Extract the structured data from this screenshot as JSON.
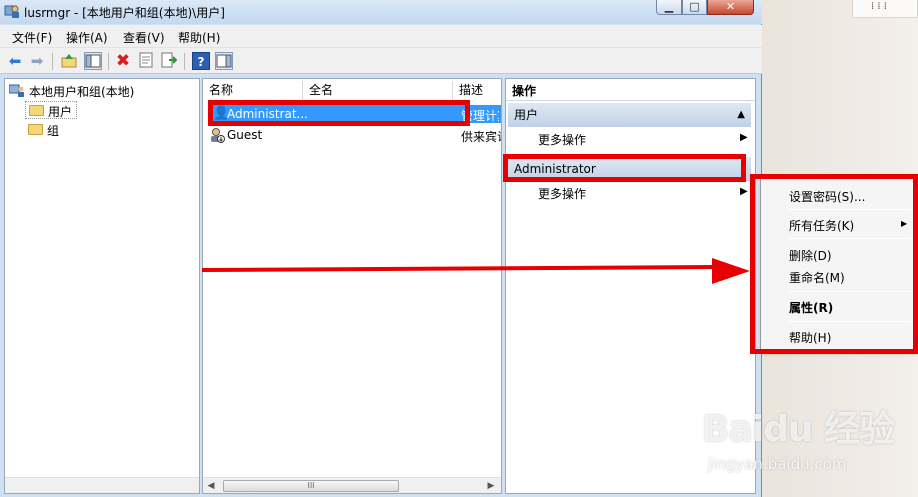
{
  "window": {
    "title": "lusrmgr - [本地用户和组(本地)\\用户]",
    "controls": {
      "minimize": "▁",
      "maximize": "□",
      "close": "✕"
    }
  },
  "menubar": [
    "文件(F)",
    "操作(A)",
    "查看(V)",
    "帮助(H)"
  ],
  "toolbar": {
    "icons": [
      "back-arrow-icon",
      "forward-arrow-icon",
      "up-folder-icon",
      "show-hide-tree-icon",
      "delete-icon",
      "properties-icon",
      "export-list-icon",
      "help-icon",
      "show-hide-action-pane-icon"
    ]
  },
  "tree": {
    "root": "本地用户和组(本地)",
    "children": [
      "用户",
      "组"
    ]
  },
  "list": {
    "columns": [
      "名称",
      "全名",
      "描述"
    ],
    "rows": [
      {
        "name": "Administrat...",
        "fullname": "",
        "desc": "管理计算"
      },
      {
        "name": "Guest",
        "fullname": "",
        "desc": "供来宾访"
      }
    ],
    "hscroll_thumb": "III"
  },
  "actions": {
    "header": "操作",
    "sections": [
      {
        "title": "用户",
        "more": "更多操作"
      },
      {
        "title": "Administrator",
        "more": "更多操作"
      }
    ]
  },
  "context_menu": {
    "items": [
      "设置密码(S)...",
      "所有任务(K)",
      "删除(D)",
      "重命名(M)",
      "属性(R)",
      "帮助(H)"
    ]
  },
  "watermark": {
    "logo_text": "Baidu 经验",
    "url": "jingyan.baidu.com"
  },
  "colors": {
    "annotation_red": "#e60000",
    "selection_blue": "#3399ff"
  }
}
